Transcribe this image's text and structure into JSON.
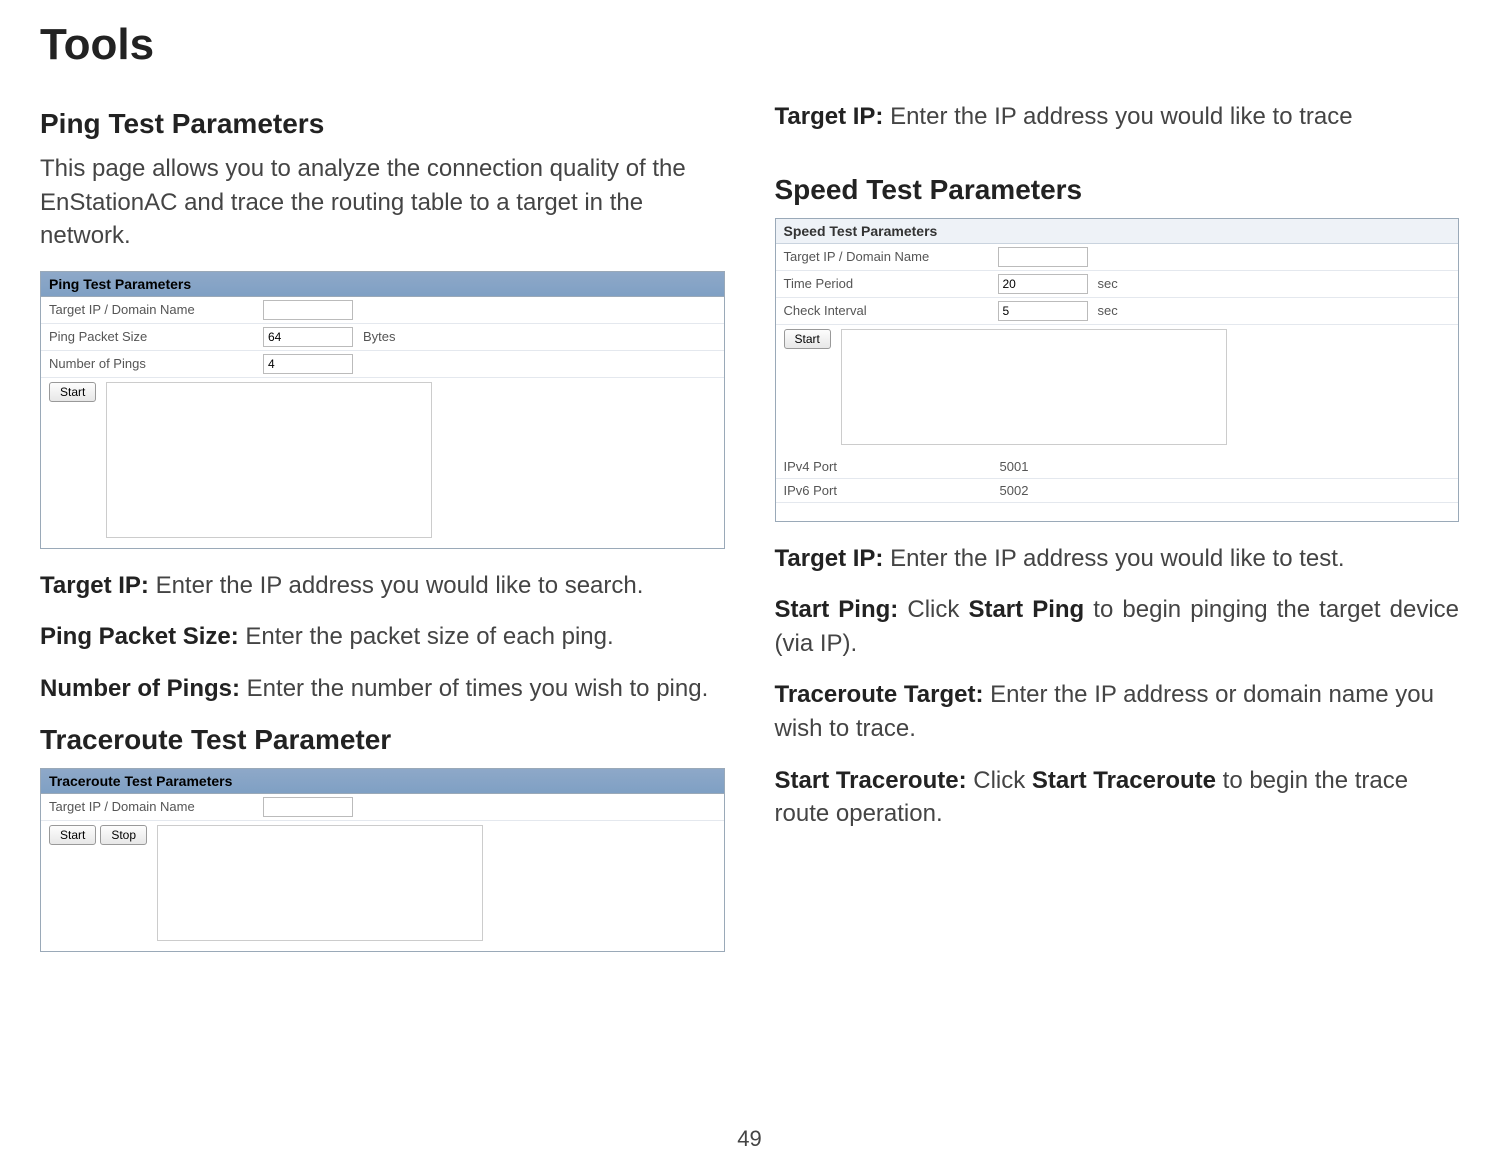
{
  "page_title": "Tools",
  "page_number": "49",
  "left": {
    "ping_heading": "Ping Test Parameters",
    "intro": "This page allows you to analyze the connection quality of the EnStationAC and trace the routing table to a target in the network.",
    "ping_panel": {
      "header": "Ping Test Parameters",
      "row1_label": "Target IP / Domain Name",
      "row1_value": "",
      "row2_label": "Ping Packet Size",
      "row2_value": "64",
      "row2_unit": "Bytes",
      "row3_label": "Number of Pings",
      "row3_value": "4",
      "start_btn": "Start"
    },
    "target_ip_label": "Target IP: ",
    "target_ip_text": "Enter the IP address you would like to search.",
    "packet_size_label": "Ping Packet Size: ",
    "packet_size_text": "Enter the packet size of each ping.",
    "num_pings_label": "Number of Pings: ",
    "num_pings_text": "Enter the number of times you wish to ping.",
    "traceroute_heading": "Traceroute Test Parameter",
    "traceroute_panel": {
      "header": "Traceroute Test Parameters",
      "row1_label": "Target IP / Domain Name",
      "row1_value": "",
      "start_btn": "Start",
      "stop_btn": "Stop"
    }
  },
  "right": {
    "target_ip_label": "Target IP: ",
    "target_ip_text": "Enter the IP address you would like to trace",
    "speed_heading": "Speed Test Parameters",
    "speed_panel": {
      "header": "Speed Test Parameters",
      "row1_label": "Target IP / Domain Name",
      "row1_value": "",
      "row2_label": "Time Period",
      "row2_value": "20",
      "row2_unit": "sec",
      "row3_label": "Check Interval",
      "row3_value": "5",
      "row3_unit": "sec",
      "start_btn": "Start",
      "row4_label": "IPv4 Port",
      "row4_value": "5001",
      "row5_label": "IPv6 Port",
      "row5_value": "5002"
    },
    "target_ip2_label": "Target IP: ",
    "target_ip2_text": "Enter the IP address you would like to test.",
    "start_ping_label": "Start Ping: ",
    "start_ping_pre": "Click ",
    "start_ping_bold": "Start Ping",
    "start_ping_post": " to begin pinging the target device (via IP).",
    "traceroute_target_label": "Traceroute Target: ",
    "traceroute_target_text": "Enter the IP address or domain name you wish to trace.",
    "start_traceroute_label": "Start Traceroute: ",
    "start_traceroute_pre": "Click ",
    "start_traceroute_bold": "Start Traceroute",
    "start_traceroute_post": " to begin the trace route operation."
  }
}
